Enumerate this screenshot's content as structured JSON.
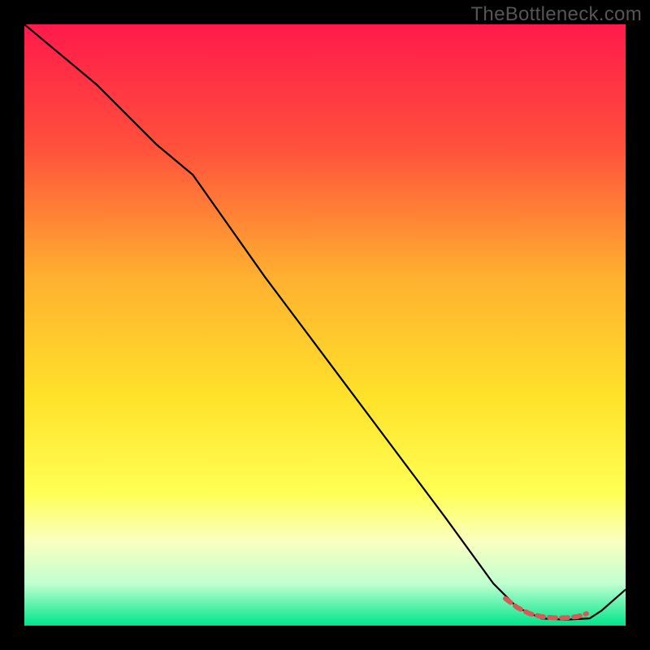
{
  "watermark": "TheBottleneck.com",
  "chart_data": {
    "type": "line",
    "title": "",
    "xlabel": "",
    "ylabel": "",
    "xlim": [
      0,
      100
    ],
    "ylim": [
      0,
      100
    ],
    "background_gradient_stops": [
      {
        "offset": 0,
        "color": "#ff1a4b"
      },
      {
        "offset": 20,
        "color": "#ff4f3c"
      },
      {
        "offset": 42,
        "color": "#ffb030"
      },
      {
        "offset": 62,
        "color": "#ffe22a"
      },
      {
        "offset": 78,
        "color": "#ffff55"
      },
      {
        "offset": 86,
        "color": "#faffc0"
      },
      {
        "offset": 93,
        "color": "#c0ffd0"
      },
      {
        "offset": 100,
        "color": "#00e58b"
      }
    ],
    "series": [
      {
        "name": "curve",
        "color": "#000000",
        "width": 2.2,
        "x": [
          0,
          12,
          22,
          28,
          40,
          55,
          70,
          78,
          82,
          86,
          90,
          94,
          96,
          100
        ],
        "y": [
          100,
          90,
          80,
          75,
          58,
          38,
          18,
          7,
          3,
          1.2,
          1,
          1.2,
          2.5,
          6
        ]
      },
      {
        "name": "highlight",
        "color": "#d65a5a",
        "width": 6,
        "dash": "8 7",
        "linecap": "round",
        "x": [
          80,
          82,
          84,
          86,
          88,
          90,
          92,
          93.5
        ],
        "y": [
          4.5,
          3.0,
          2.0,
          1.5,
          1.3,
          1.3,
          1.5,
          2.0
        ]
      }
    ]
  }
}
